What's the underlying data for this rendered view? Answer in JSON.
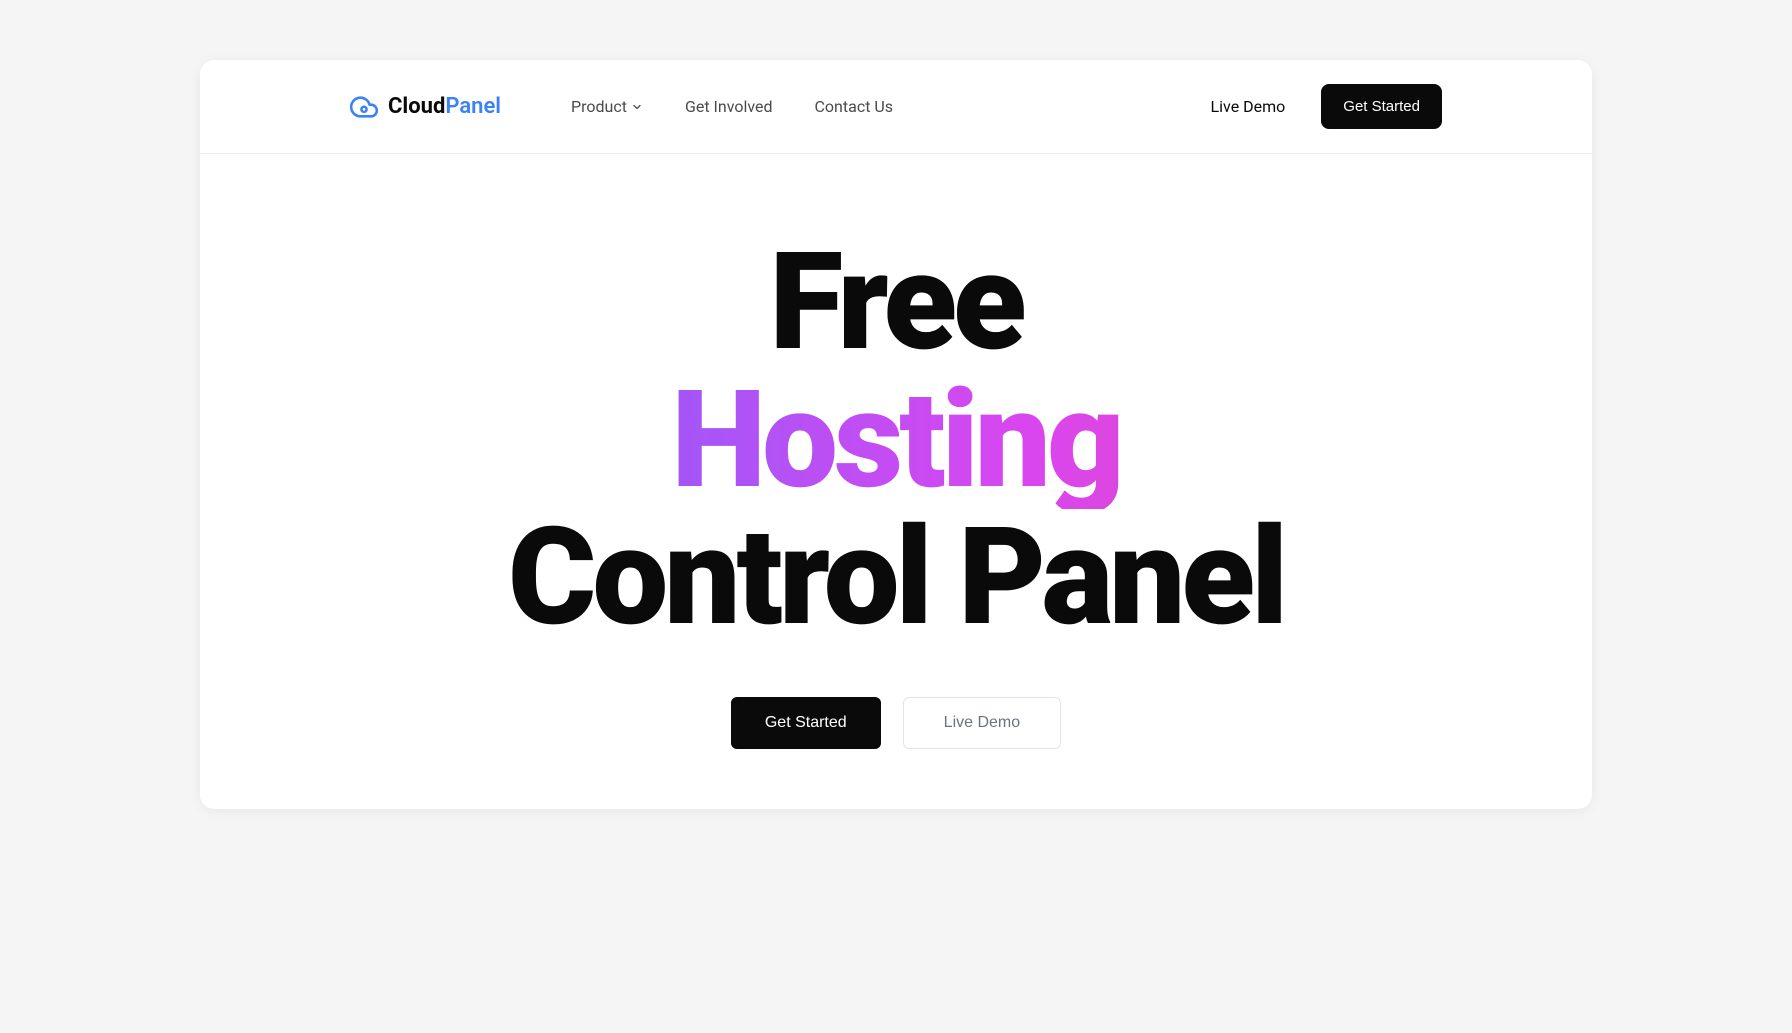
{
  "logo": {
    "text1": "Cloud",
    "text2": "Panel"
  },
  "nav": {
    "product": "Product",
    "get_involved": "Get Involved",
    "contact_us": "Contact Us"
  },
  "header_actions": {
    "live_demo": "Live Demo",
    "get_started": "Get Started"
  },
  "hero": {
    "line1": "Free",
    "line2": "Hosting",
    "line3": "Control Panel",
    "btn_get_started": "Get Started",
    "btn_live_demo": "Live Demo"
  }
}
